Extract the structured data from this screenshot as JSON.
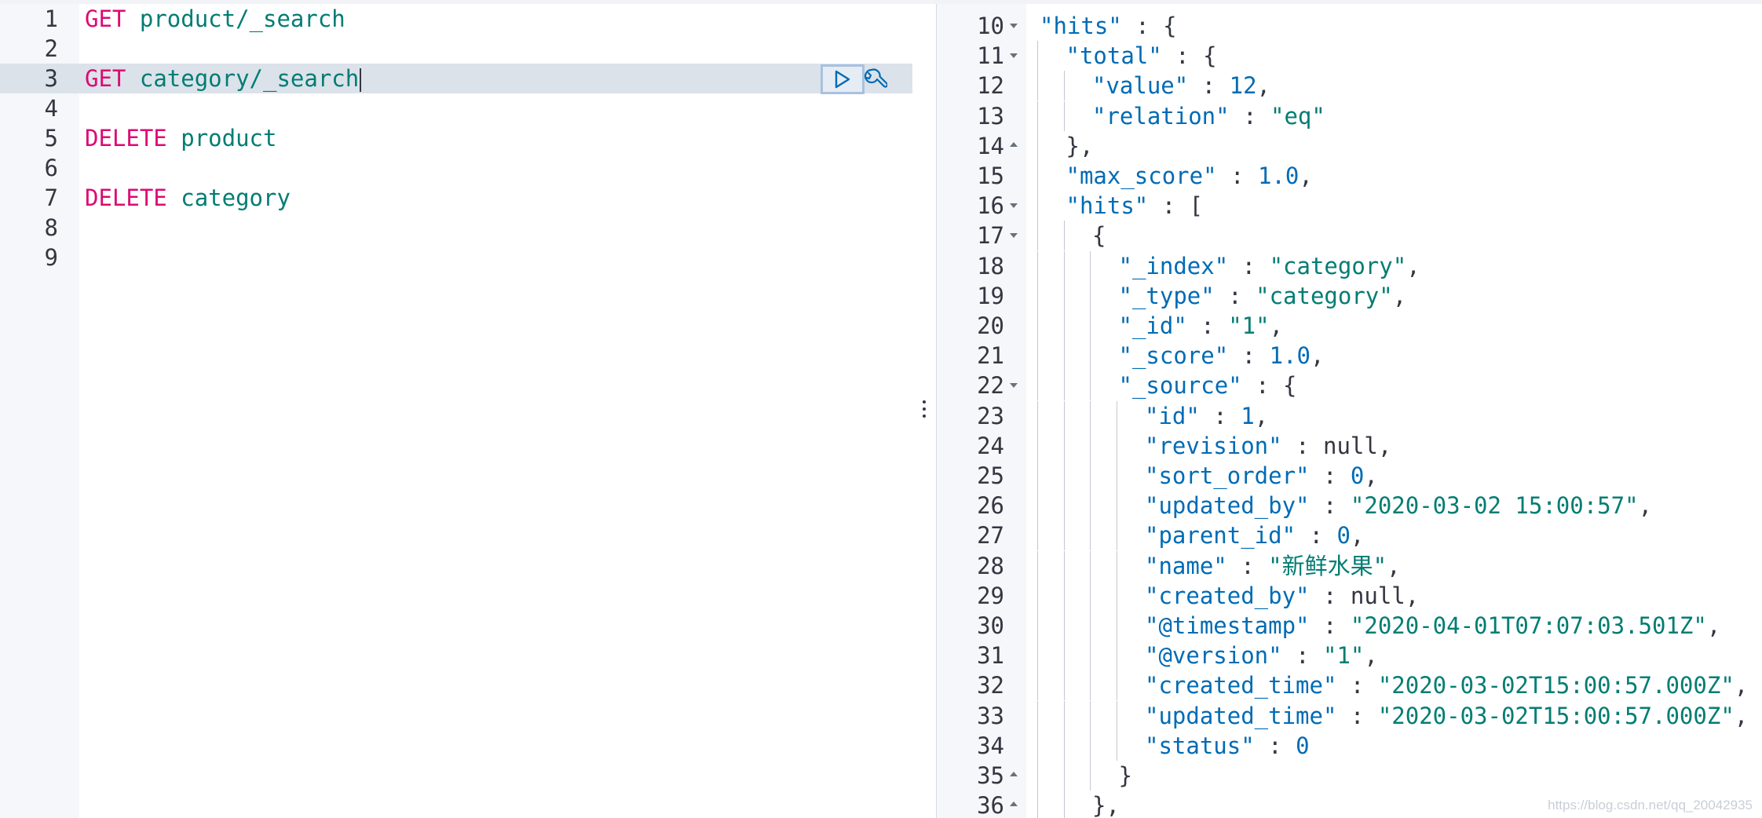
{
  "editor": {
    "lines": [
      {
        "num": "1",
        "method": "GET",
        "path": "product/_search"
      },
      {
        "num": "2",
        "method": "",
        "path": ""
      },
      {
        "num": "3",
        "method": "GET",
        "path": "category/_search",
        "active": true
      },
      {
        "num": "4",
        "method": "",
        "path": ""
      },
      {
        "num": "5",
        "method": "DELETE",
        "path": "product"
      },
      {
        "num": "6",
        "method": "",
        "path": ""
      },
      {
        "num": "7",
        "method": "DELETE",
        "path": "category"
      },
      {
        "num": "8",
        "method": "",
        "path": ""
      },
      {
        "num": "9",
        "method": "",
        "path": ""
      }
    ],
    "actions": {
      "run_icon": "play-icon",
      "settings_icon": "wrench-icon"
    }
  },
  "output": {
    "lines": [
      {
        "num": "10",
        "indent": 0,
        "fold": "down",
        "tokens": [
          [
            "k",
            "\"hits\""
          ],
          [
            "p",
            " : {"
          ]
        ]
      },
      {
        "num": "11",
        "indent": 1,
        "fold": "down",
        "tokens": [
          [
            "k",
            "\"total\""
          ],
          [
            "p",
            " : {"
          ]
        ]
      },
      {
        "num": "12",
        "indent": 2,
        "fold": "",
        "tokens": [
          [
            "k",
            "\"value\""
          ],
          [
            "p",
            " : "
          ],
          [
            "n",
            "12"
          ],
          [
            "p",
            ","
          ]
        ]
      },
      {
        "num": "13",
        "indent": 2,
        "fold": "",
        "tokens": [
          [
            "k",
            "\"relation\""
          ],
          [
            "p",
            " : "
          ],
          [
            "s",
            "\"eq\""
          ]
        ]
      },
      {
        "num": "14",
        "indent": 1,
        "fold": "up",
        "tokens": [
          [
            "p",
            "},"
          ]
        ]
      },
      {
        "num": "15",
        "indent": 1,
        "fold": "",
        "tokens": [
          [
            "k",
            "\"max_score\""
          ],
          [
            "p",
            " : "
          ],
          [
            "n",
            "1.0"
          ],
          [
            "p",
            ","
          ]
        ]
      },
      {
        "num": "16",
        "indent": 1,
        "fold": "down",
        "tokens": [
          [
            "k",
            "\"hits\""
          ],
          [
            "p",
            " : ["
          ]
        ]
      },
      {
        "num": "17",
        "indent": 2,
        "fold": "down",
        "tokens": [
          [
            "p",
            "{"
          ]
        ]
      },
      {
        "num": "18",
        "indent": 3,
        "fold": "",
        "tokens": [
          [
            "k",
            "\"_index\""
          ],
          [
            "p",
            " : "
          ],
          [
            "s",
            "\"category\""
          ],
          [
            "p",
            ","
          ]
        ]
      },
      {
        "num": "19",
        "indent": 3,
        "fold": "",
        "tokens": [
          [
            "k",
            "\"_type\""
          ],
          [
            "p",
            " : "
          ],
          [
            "s",
            "\"category\""
          ],
          [
            "p",
            ","
          ]
        ]
      },
      {
        "num": "20",
        "indent": 3,
        "fold": "",
        "tokens": [
          [
            "k",
            "\"_id\""
          ],
          [
            "p",
            " : "
          ],
          [
            "s",
            "\"1\""
          ],
          [
            "p",
            ","
          ]
        ]
      },
      {
        "num": "21",
        "indent": 3,
        "fold": "",
        "tokens": [
          [
            "k",
            "\"_score\""
          ],
          [
            "p",
            " : "
          ],
          [
            "n",
            "1.0"
          ],
          [
            "p",
            ","
          ]
        ]
      },
      {
        "num": "22",
        "indent": 3,
        "fold": "down",
        "tokens": [
          [
            "k",
            "\"_source\""
          ],
          [
            "p",
            " : {"
          ]
        ]
      },
      {
        "num": "23",
        "indent": 4,
        "fold": "",
        "tokens": [
          [
            "k",
            "\"id\""
          ],
          [
            "p",
            " : "
          ],
          [
            "n",
            "1"
          ],
          [
            "p",
            ","
          ]
        ]
      },
      {
        "num": "24",
        "indent": 4,
        "fold": "",
        "tokens": [
          [
            "k",
            "\"revision\""
          ],
          [
            "p",
            " : "
          ],
          [
            "p",
            "null"
          ],
          [
            "p",
            ","
          ]
        ]
      },
      {
        "num": "25",
        "indent": 4,
        "fold": "",
        "tokens": [
          [
            "k",
            "\"sort_order\""
          ],
          [
            "p",
            " : "
          ],
          [
            "n",
            "0"
          ],
          [
            "p",
            ","
          ]
        ]
      },
      {
        "num": "26",
        "indent": 4,
        "fold": "",
        "tokens": [
          [
            "k",
            "\"updated_by\""
          ],
          [
            "p",
            " : "
          ],
          [
            "s",
            "\"2020-03-02 15:00:57\""
          ],
          [
            "p",
            ","
          ]
        ]
      },
      {
        "num": "27",
        "indent": 4,
        "fold": "",
        "tokens": [
          [
            "k",
            "\"parent_id\""
          ],
          [
            "p",
            " : "
          ],
          [
            "n",
            "0"
          ],
          [
            "p",
            ","
          ]
        ]
      },
      {
        "num": "28",
        "indent": 4,
        "fold": "",
        "tokens": [
          [
            "k",
            "\"name\""
          ],
          [
            "p",
            " : "
          ],
          [
            "s",
            "\"新鲜水果\""
          ],
          [
            "p",
            ","
          ]
        ]
      },
      {
        "num": "29",
        "indent": 4,
        "fold": "",
        "tokens": [
          [
            "k",
            "\"created_by\""
          ],
          [
            "p",
            " : "
          ],
          [
            "p",
            "null"
          ],
          [
            "p",
            ","
          ]
        ]
      },
      {
        "num": "30",
        "indent": 4,
        "fold": "",
        "tokens": [
          [
            "k",
            "\"@timestamp\""
          ],
          [
            "p",
            " : "
          ],
          [
            "s",
            "\"2020-04-01T07:07:03.501Z\""
          ],
          [
            "p",
            ","
          ]
        ]
      },
      {
        "num": "31",
        "indent": 4,
        "fold": "",
        "tokens": [
          [
            "k",
            "\"@version\""
          ],
          [
            "p",
            " : "
          ],
          [
            "s",
            "\"1\""
          ],
          [
            "p",
            ","
          ]
        ]
      },
      {
        "num": "32",
        "indent": 4,
        "fold": "",
        "tokens": [
          [
            "k",
            "\"created_time\""
          ],
          [
            "p",
            " : "
          ],
          [
            "s",
            "\"2020-03-02T15:00:57.000Z\""
          ],
          [
            "p",
            ","
          ]
        ]
      },
      {
        "num": "33",
        "indent": 4,
        "fold": "",
        "tokens": [
          [
            "k",
            "\"updated_time\""
          ],
          [
            "p",
            " : "
          ],
          [
            "s",
            "\"2020-03-02T15:00:57.000Z\""
          ],
          [
            "p",
            ","
          ]
        ]
      },
      {
        "num": "34",
        "indent": 4,
        "fold": "",
        "tokens": [
          [
            "k",
            "\"status\""
          ],
          [
            "p",
            " : "
          ],
          [
            "n",
            "0"
          ]
        ]
      },
      {
        "num": "35",
        "indent": 3,
        "fold": "up",
        "tokens": [
          [
            "p",
            "}"
          ]
        ]
      },
      {
        "num": "36",
        "indent": 2,
        "fold": "up",
        "tokens": [
          [
            "p",
            "},"
          ]
        ]
      }
    ]
  },
  "watermark": "https://blog.csdn.net/qq_20042935"
}
